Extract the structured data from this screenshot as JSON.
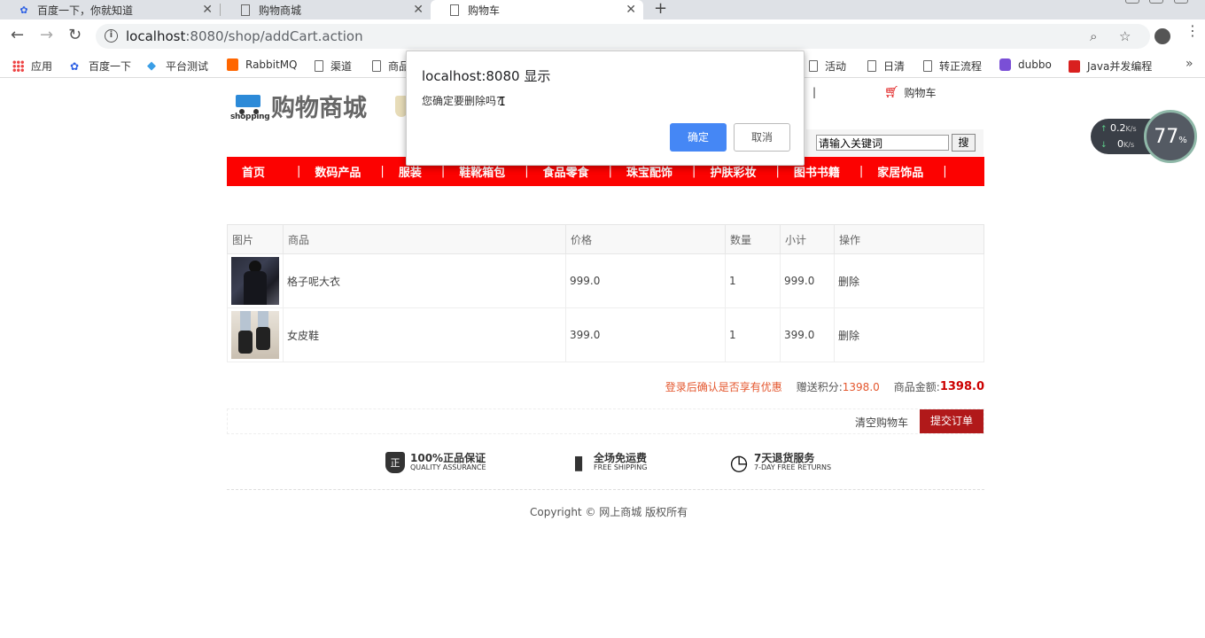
{
  "browser": {
    "tabs": [
      {
        "title": "百度一下，你就知道",
        "icon": "baidu-paw-icon"
      },
      {
        "title": "购物商城",
        "icon": "page-icon"
      },
      {
        "title": "购物车",
        "icon": "page-icon",
        "active": true
      }
    ],
    "close_glyph": "✕",
    "new_tab_glyph": "+",
    "url_host": "localhost",
    "url_rest": ":8080/shop/addCart.action",
    "bookmarks": [
      {
        "label": "应用",
        "icon": "apps-grid-icon"
      },
      {
        "label": "百度一下",
        "icon": "baidu-paw-icon"
      },
      {
        "label": "平台测试",
        "icon": "diamond-icon"
      },
      {
        "label": "RabbitMQ",
        "icon": "rabbitmq-icon"
      },
      {
        "label": "渠道",
        "icon": "page-icon"
      },
      {
        "label": "商品",
        "icon": "page-icon"
      },
      {
        "label": "活动",
        "icon": "page-icon"
      },
      {
        "label": "日清",
        "icon": "page-icon"
      },
      {
        "label": "转正流程",
        "icon": "page-icon"
      },
      {
        "label": "dubbo",
        "icon": "dubbo-icon"
      },
      {
        "label": "Java并发编程",
        "icon": "csdn-icon"
      }
    ],
    "bookmarks_more": "»"
  },
  "header": {
    "logo_word": "shopping",
    "logo_text": "购物商城",
    "separator": "|",
    "cart_link": "购物车",
    "search_placeholder": "请输入关键词",
    "search_button": "搜"
  },
  "nav": {
    "items": [
      "首页",
      "数码产品",
      "服装",
      "鞋靴箱包",
      "食品零食",
      "珠宝配饰",
      "护肤彩妆",
      "图书书籍",
      "家居饰品"
    ],
    "separator": "|"
  },
  "cart": {
    "columns": [
      "图片",
      "商品",
      "价格",
      "数量",
      "小计",
      "操作"
    ],
    "rows": [
      {
        "name": "格子呢大衣",
        "price": "999.0",
        "qty": "1",
        "subtotal": "999.0",
        "action": "删除"
      },
      {
        "name": "女皮鞋",
        "price": "399.0",
        "qty": "1",
        "subtotal": "399.0",
        "action": "删除"
      }
    ],
    "login_hint": "登录后确认是否享有优惠",
    "points_label": "赠送积分: ",
    "points_value": "1398.0",
    "amount_label": "商品金额: ",
    "amount_value": "1398.0",
    "clear_label": "清空购物车",
    "submit_label": "提交订单"
  },
  "services": [
    {
      "title": "100%正品保证",
      "sub": "QUALITY ASSURANCE",
      "icon": "shield-zheng-icon",
      "glyph": "正"
    },
    {
      "title": "全场免运费",
      "sub": "FREE SHIPPING",
      "icon": "box-icon",
      "glyph": "▮"
    },
    {
      "title": "7天退货服务",
      "sub": "7-DAY FREE RETURNS",
      "icon": "clock-icon",
      "glyph": "◷"
    }
  ],
  "footer": {
    "copyright": "Copyright © 网上商城 版权所有"
  },
  "net_widget": {
    "up": "0.2",
    "up_unit": "K/s",
    "down": "0",
    "down_unit": "K/s",
    "gauge": "77",
    "gauge_unit": "%"
  },
  "dialog": {
    "title": "localhost:8080 显示",
    "message": "您确定要删除吗?",
    "ok": "确定",
    "cancel": "取消"
  },
  "colors": {
    "nav_red": "#fc0201",
    "submit": "#b1191a",
    "dialog_ok": "#4587f5",
    "accent_orange": "#e4572e"
  }
}
